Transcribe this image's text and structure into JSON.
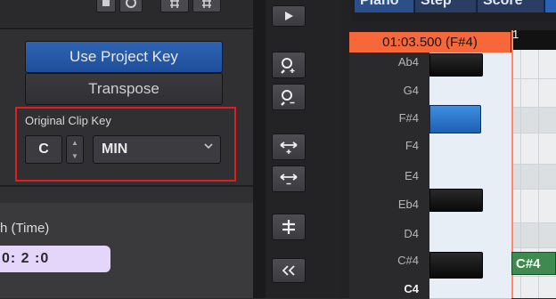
{
  "inspector": {
    "use_project_key_label": "Use Project Key",
    "transpose_label": "Transpose",
    "original_clip_key": {
      "label": "Original Clip Key",
      "key": "C",
      "scale": "MIN"
    },
    "time_label": "h (Time)",
    "time_value": "0: 2 :0"
  },
  "piano_roll": {
    "tabs": [
      "Piano",
      "Step",
      "Score"
    ],
    "position_readout": "01:03.500 (F#4)",
    "ruler_number": "1",
    "key_labels": [
      "Ab4",
      "G4",
      "F#4",
      "F4",
      "E4",
      "Eb4",
      "D4",
      "C#4",
      "C4"
    ],
    "note_label": "C#4"
  },
  "colors": {
    "accent_blue": "#2f64b4",
    "highlight_red": "#e11d1d",
    "position_orange": "#f6683a",
    "note_green": "#3f8a4f",
    "time_field": "#e4d6fb"
  },
  "icons": [
    "stop-icon",
    "loop-icon",
    "play-icon",
    "zoom-in-icon",
    "zoom-out-icon",
    "expand-horizontal-icon",
    "shrink-horizontal-icon",
    "snap-icon",
    "collapse-left-icon"
  ]
}
